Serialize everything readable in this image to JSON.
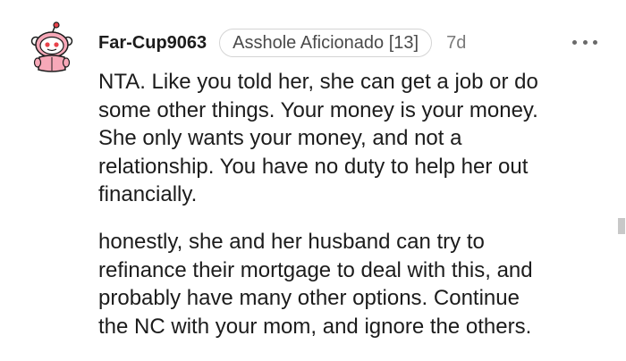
{
  "comment": {
    "username": "Far-Cup9063",
    "flair": "Asshole Aficionado [13]",
    "timestamp": "7d",
    "more_icon": "more-horizontal-icon",
    "avatar_icon": "snoo-avatar-icon",
    "paragraphs": [
      {
        "lines": [
          "NTA. Like you told her, she can get a job or do",
          "some other things. Your money is your money.",
          "She only wants your money, and not a",
          "relationship. You have no duty to help her out",
          "financially."
        ]
      },
      {
        "lines": [
          "honestly, she and her husband can try to",
          "refinance their mortgage to deal with this, and",
          "probably have many other options. Continue",
          "the NC with your mom, and ignore the others."
        ]
      }
    ]
  },
  "colors": {
    "text": "#1c1c1c",
    "flair_border": "#d4d4d4",
    "meta": "#7a7a7a",
    "avatar_pink": "#f7a8b8",
    "avatar_red": "#e8424a"
  }
}
